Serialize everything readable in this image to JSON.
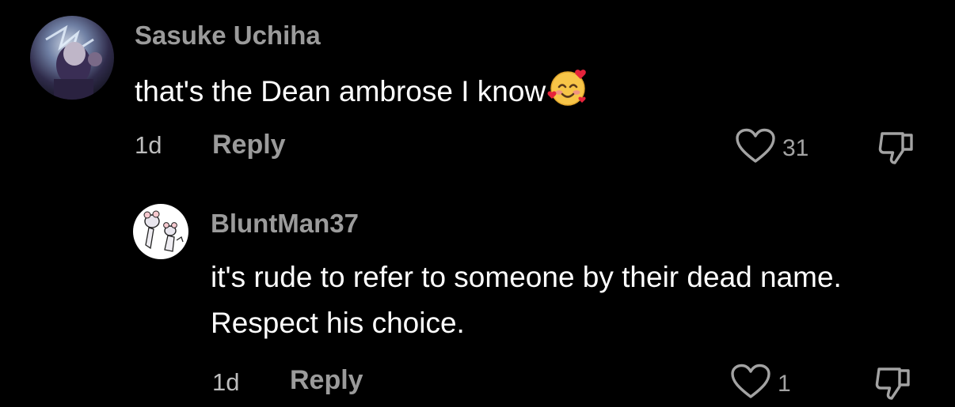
{
  "comments": [
    {
      "username": "Sasuke Uchiha",
      "text": "that's the Dean ambrose I know",
      "emoji": "smiling-face-with-hearts",
      "time": "1d",
      "reply_label": "Reply",
      "likes": "31"
    }
  ],
  "replies": [
    {
      "username": "BluntMan37",
      "text": "it's rude to refer to someone by their dead name. Respect his choice.",
      "time": "1d",
      "reply_label": "Reply",
      "likes": "1"
    }
  ],
  "colors": {
    "background": "#000000",
    "username": "#9b9b9b",
    "text": "#ffffff",
    "meta": "#bdbdbd"
  }
}
